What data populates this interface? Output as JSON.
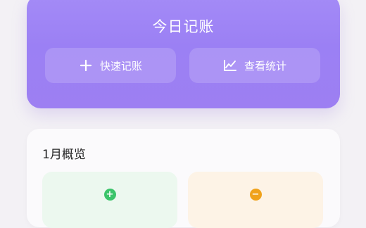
{
  "header": {
    "title": "今日记账",
    "buttons": [
      {
        "label": "快速记账",
        "icon": "plus-icon"
      },
      {
        "label": "查看统计",
        "icon": "trend-chart-icon"
      }
    ]
  },
  "overview": {
    "title": "1月概览",
    "income_icon": "plus-circle-icon",
    "expense_icon": "minus-circle-icon"
  },
  "colors": {
    "accent": "#9b80f4",
    "income": "#3bc46a",
    "expense": "#f0a21b"
  }
}
